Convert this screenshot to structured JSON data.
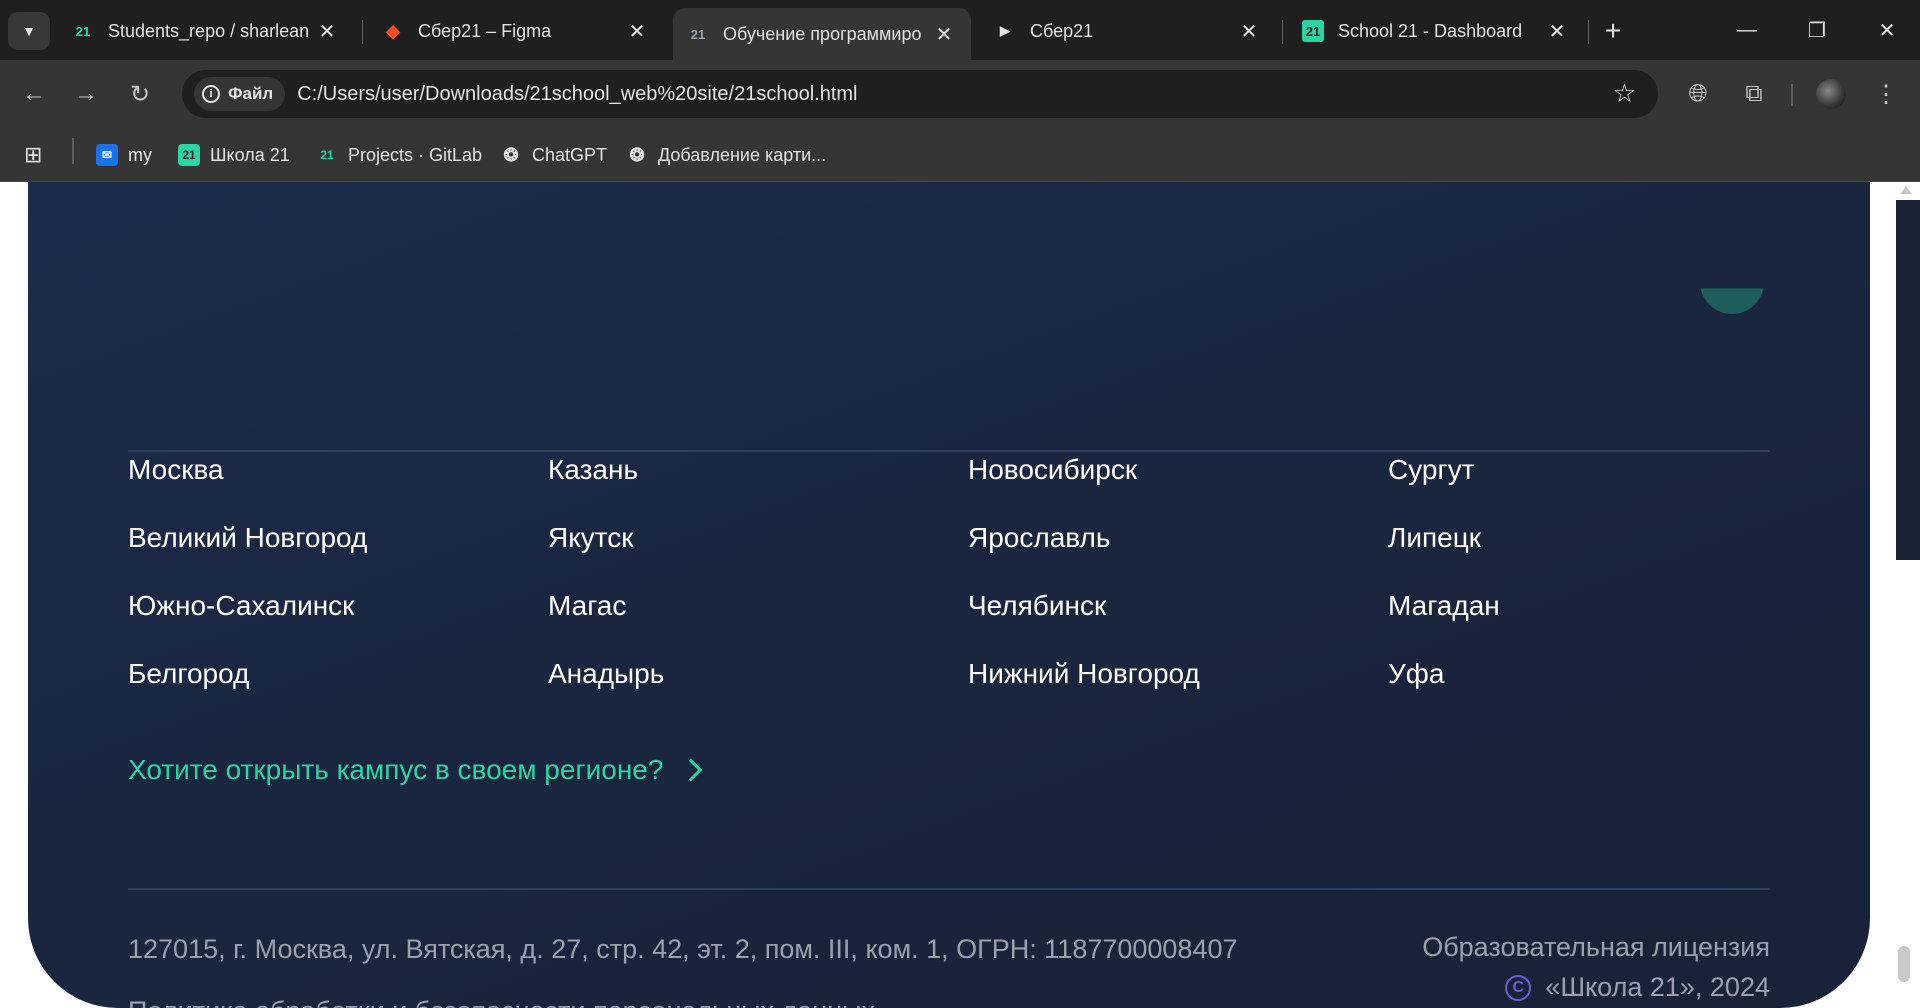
{
  "browser": {
    "tabs": [
      {
        "title": "Students_repo / sharlean",
        "icon": "school21-logo-icon",
        "active": false
      },
      {
        "title": "Сбер21 – Figma",
        "icon": "figma-icon",
        "active": false
      },
      {
        "title": "Обучение программиро",
        "icon": "school21-logo-icon",
        "active": true
      },
      {
        "title": "Сбер21",
        "icon": "play-icon",
        "active": false
      },
      {
        "title": "School 21 - Dashboard",
        "icon": "school21-logo-icon",
        "active": false
      }
    ],
    "address_chip": "Файл",
    "url": "C:/Users/user/Downloads/21school_web%20site/21school.html",
    "bookmarks": [
      {
        "label": "my",
        "icon": "mail-icon"
      },
      {
        "label": "Школа 21",
        "icon": "school21-logo-icon"
      },
      {
        "label": "Projects · GitLab",
        "icon": "school21-logo-icon"
      },
      {
        "label": "ChatGPT",
        "icon": "chatgpt-icon"
      },
      {
        "label": "Добавление карти...",
        "icon": "chatgpt-icon"
      }
    ],
    "accent_color": "#29d6a3"
  },
  "footer": {
    "cities": [
      [
        "Москва",
        "Казань",
        "Новосибирск",
        "Сургут"
      ],
      [
        "Великий Новгород",
        "Якутск",
        "Ярославль",
        "Липецк"
      ],
      [
        "Южно-Сахалинск",
        "Магас",
        "Челябинск",
        "Магадан"
      ],
      [
        "Белгород",
        "Анадырь",
        "Нижний Новгород",
        "Уфа"
      ]
    ],
    "open_campus_link": "Хотите открыть кампус в своем регионе?",
    "address": "127015, г. Москва, ул. Вятская, д. 27, стр. 42, эт. 2, пом. III, ком. 1, ОГРН: 1187700008407",
    "policy_link": "Политика обработки и безопасности персональных данных",
    "license_link": "Образовательная лицензия",
    "copyright_symbol": "C",
    "copyright": "«Школа 21», 2024"
  }
}
